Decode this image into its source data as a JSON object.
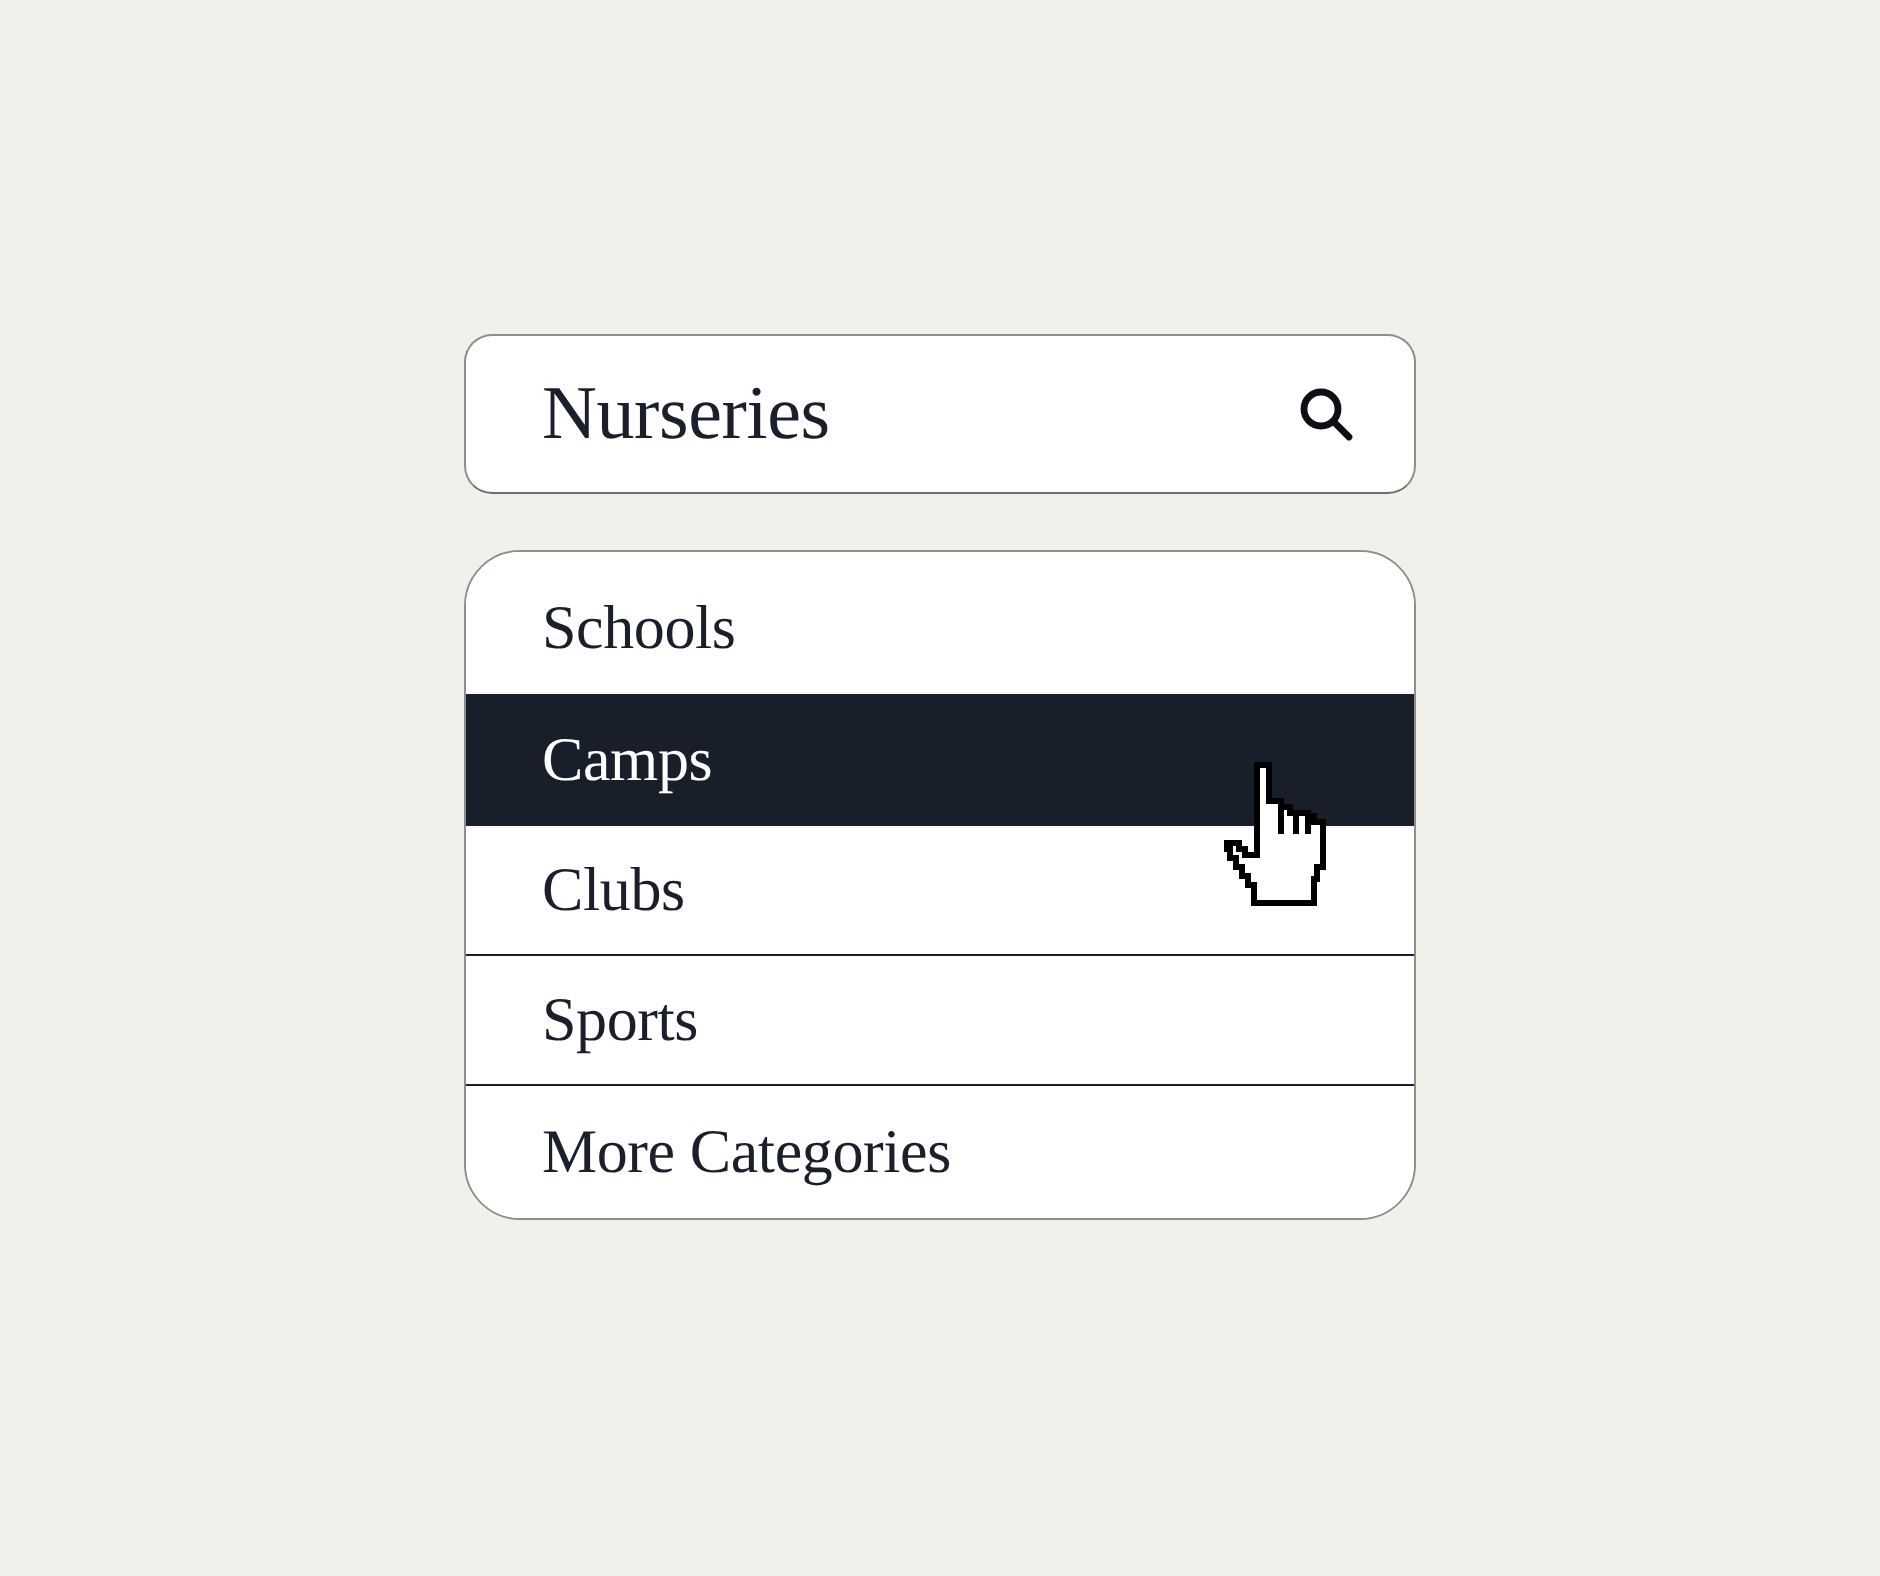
{
  "search": {
    "value": "Nurseries"
  },
  "categories": [
    {
      "label": "Schools",
      "selected": false
    },
    {
      "label": "Camps",
      "selected": true
    },
    {
      "label": "Clubs",
      "selected": false
    },
    {
      "label": "Sports",
      "selected": false
    },
    {
      "label": "More Categories",
      "selected": false
    }
  ]
}
